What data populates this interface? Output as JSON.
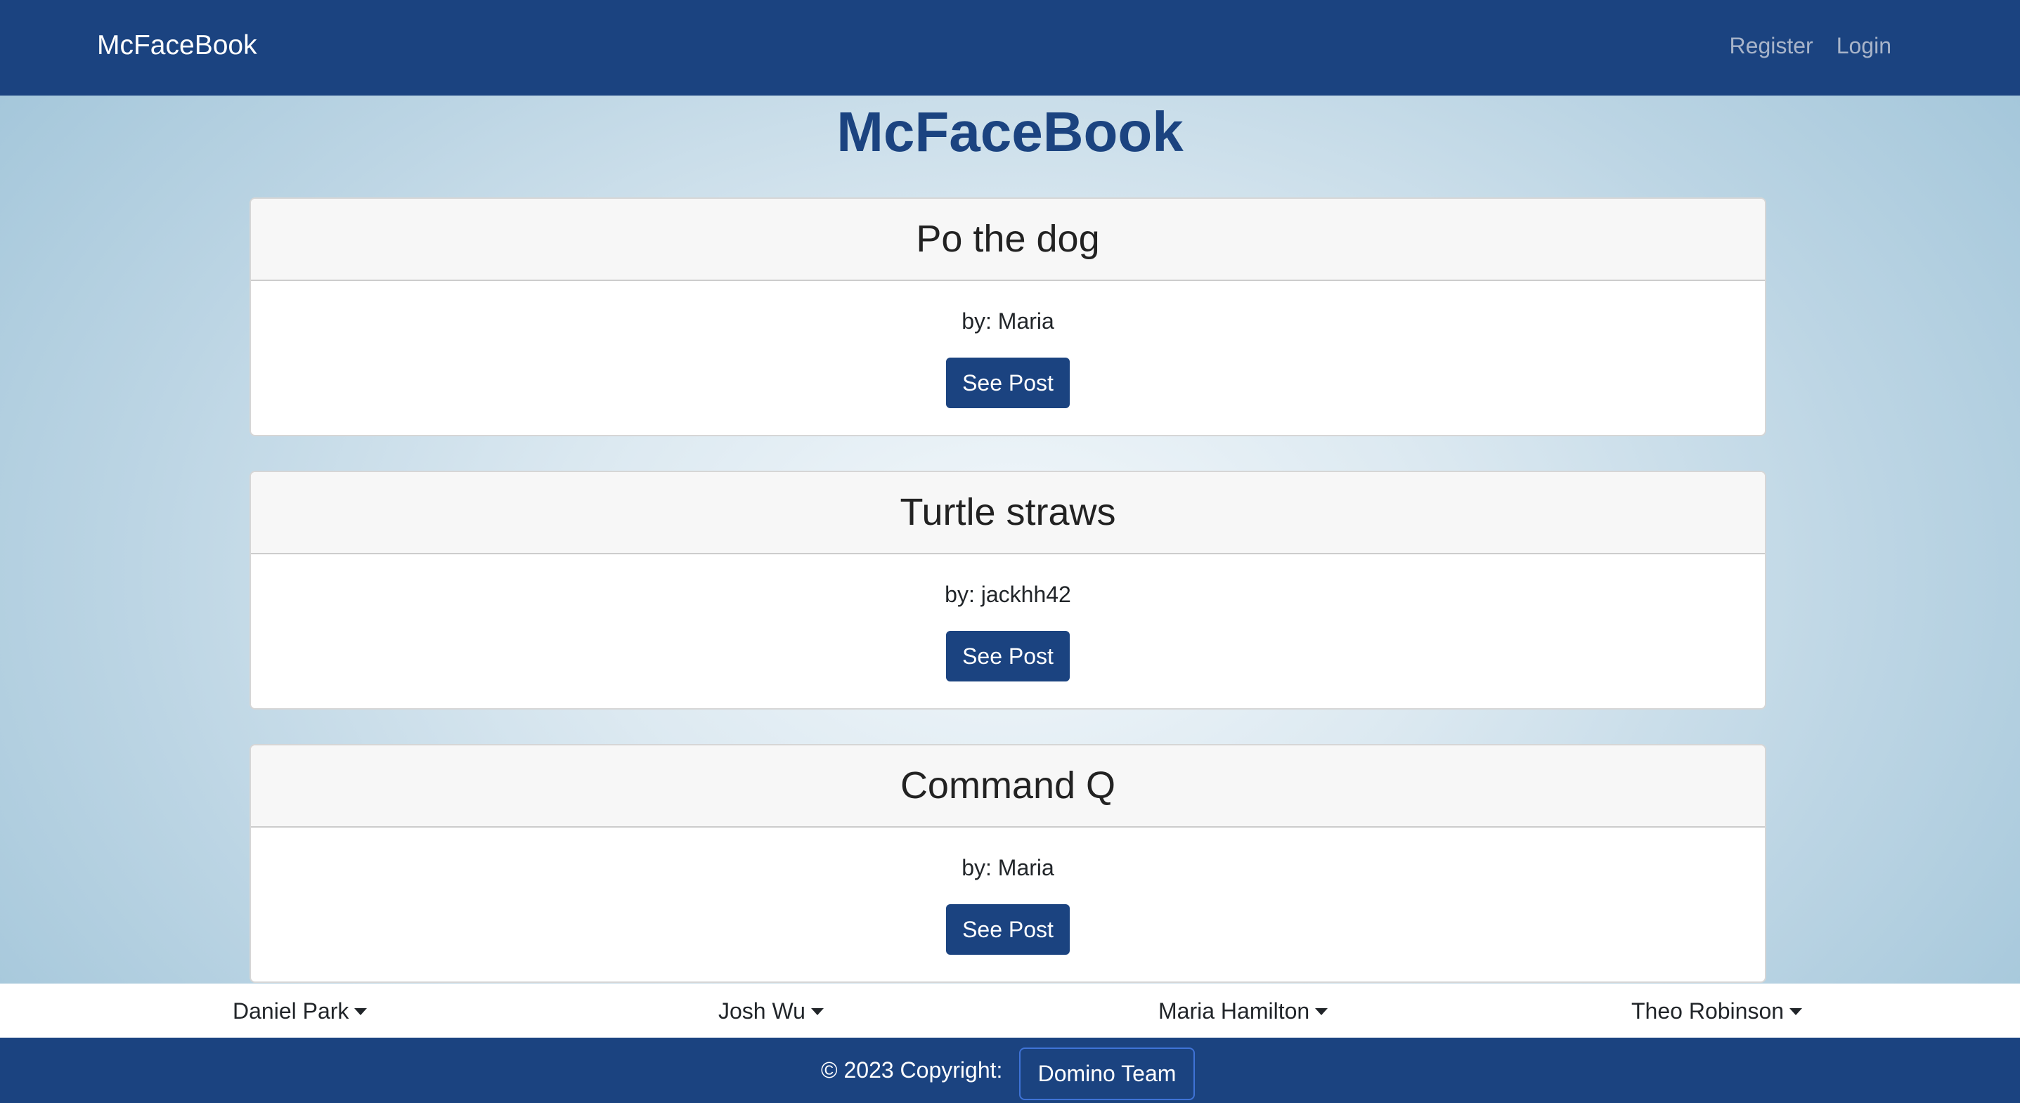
{
  "navbar": {
    "brand": "McFaceBook",
    "links": [
      "Register",
      "Login"
    ]
  },
  "page_title": "McFaceBook",
  "posts": [
    {
      "title": "Po the dog",
      "author": "by: Maria",
      "button": "See Post"
    },
    {
      "title": "Turtle straws",
      "author": "by: jackhh42",
      "button": "See Post"
    },
    {
      "title": "Command Q",
      "author": "by: Maria",
      "button": "See Post"
    }
  ],
  "members": [
    "Daniel Park",
    "Josh Wu",
    "Maria Hamilton",
    "Theo Robinson"
  ],
  "footer": {
    "copyright": "© 2023 Copyright:",
    "team": "Domino Team"
  },
  "colors": {
    "primary": "#1b4380",
    "outline": "#3f73d6"
  }
}
